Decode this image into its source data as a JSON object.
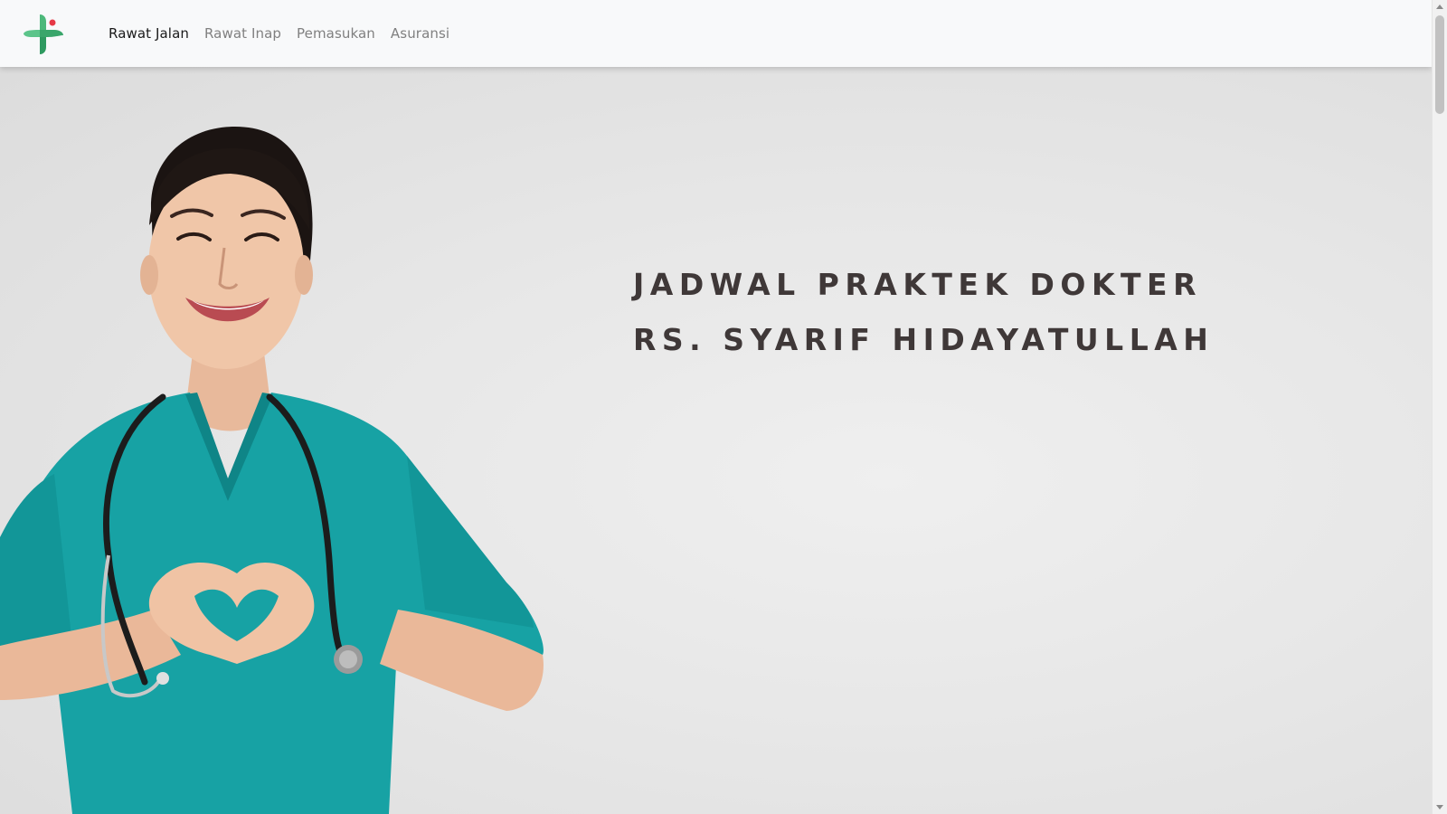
{
  "nav": {
    "logo_icon": "medical-cross-logo-icon",
    "links": [
      {
        "label": "Rawat Jalan",
        "active": true
      },
      {
        "label": "Rawat Inap",
        "active": false
      },
      {
        "label": "Pemasukan",
        "active": false
      },
      {
        "label": "Asuransi",
        "active": false
      }
    ]
  },
  "hero": {
    "title_line1": "JADWAL PRAKTEK DOKTER",
    "title_line2": "RS. SYARIF HIDAYATULLAH",
    "photo": "nurse-heart-hands-photo"
  },
  "colors": {
    "logo_green": "#4cb87a",
    "logo_dark_green": "#2f9a60",
    "logo_red_dot": "#e63946",
    "scrubs_teal": "#17a2a4",
    "title_text": "#3f3838",
    "navbar_bg": "#f8f9fa"
  }
}
